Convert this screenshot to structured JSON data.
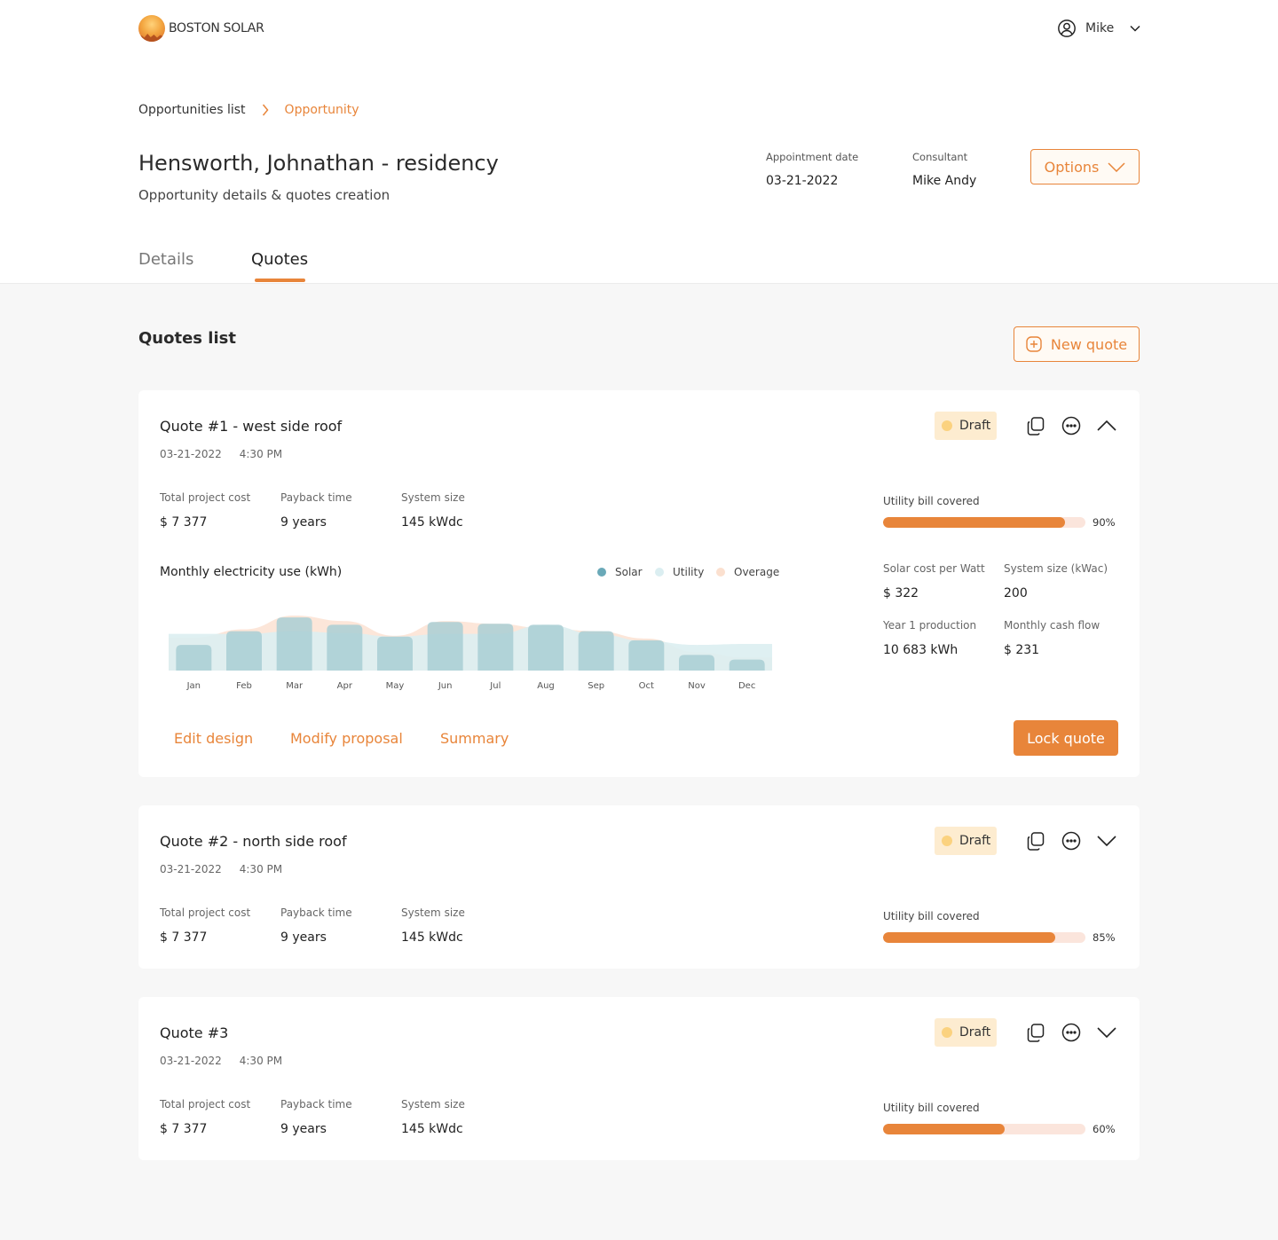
{
  "brand": {
    "name": "BOSTON SOLAR"
  },
  "user": {
    "name": "Mike"
  },
  "breadcrumb": {
    "items": [
      "Opportunities list",
      "Opportunity"
    ]
  },
  "opportunity": {
    "title": "Hensworth, Johnathan - residency",
    "subtitle": "Opportunity details & quotes creation",
    "appointment_label": "Appointment date",
    "appointment_value": "03-21-2022",
    "consultant_label": "Consultant",
    "consultant_value": "Mike Andy",
    "options_label": "Options"
  },
  "tabs": [
    "Details",
    "Quotes"
  ],
  "active_tab": "Quotes",
  "quotes_section": {
    "title": "Quotes list",
    "new_quote_label": "New quote"
  },
  "stat_labels": {
    "cost": "Total project cost",
    "payback": "Payback time",
    "size": "System size",
    "utility": "Utility bill covered",
    "cost_per_watt": "Solar cost per Watt",
    "size_kwac": "System size (kWac)",
    "year1": "Year 1 production",
    "cashflow": "Monthly cash flow"
  },
  "quotes": [
    {
      "title": "Quote #1 - west side roof",
      "date": "03-21-2022",
      "time": "4:30 PM",
      "status": "Draft",
      "expanded": true,
      "total_cost": "$ 7 377",
      "payback": "9 years",
      "system_size": "145 kWdc",
      "utility_pct": 90,
      "utility_pct_label": "90%",
      "cost_per_watt": "$ 322",
      "size_kwac": "200",
      "year1": "10 683 kWh",
      "cashflow": "$ 231",
      "actions": [
        "Edit design",
        "Modify proposal",
        "Summary"
      ],
      "lock_label": "Lock quote"
    },
    {
      "title": "Quote #2 - north side roof",
      "date": "03-21-2022",
      "time": "4:30 PM",
      "status": "Draft",
      "expanded": false,
      "total_cost": "$ 7 377",
      "payback": "9 years",
      "system_size": "145 kWdc",
      "utility_pct": 85,
      "utility_pct_label": "85%"
    },
    {
      "title": "Quote #3",
      "date": "03-21-2022",
      "time": "4:30 PM",
      "status": "Draft",
      "expanded": false,
      "total_cost": "$ 7 377",
      "payback": "9 years",
      "system_size": "145 kWdc",
      "utility_pct": 60,
      "utility_pct_label": "60%"
    }
  ],
  "colors": {
    "accent": "#e8853a",
    "solar": "#6aa9b8",
    "utility": "#dbeef1",
    "overage": "#fbe0cf",
    "bar": "#a9ced4",
    "badge_bg": "#fdecd0",
    "badge_dot": "#fbd27f"
  },
  "icons": {
    "user": "user-circle-icon",
    "dropdown": "chevron-down-icon",
    "breadcrumb_sep": "chevron-right-icon",
    "new_quote": "plus-square-icon",
    "copy": "copy-icon",
    "more": "more-horizontal-icon",
    "collapse": "chevron-up-icon",
    "expand": "chevron-down-icon"
  },
  "chart_data": {
    "type": "bar",
    "title": "Monthly electricity use (kWh)",
    "categories": [
      "Jan",
      "Feb",
      "Mar",
      "Apr",
      "May",
      "Jun",
      "Jul",
      "Aug",
      "Sep",
      "Oct",
      "Nov",
      "Dec"
    ],
    "legend": [
      "Solar",
      "Utility",
      "Overage"
    ],
    "bar_values": [
      28,
      43,
      58,
      50,
      37,
      53,
      51,
      50,
      43,
      33,
      17,
      12
    ],
    "utility_values": [
      40,
      40,
      43,
      41,
      37,
      40,
      40,
      50,
      40,
      32,
      28,
      29
    ],
    "overage_values": [
      36,
      45,
      60,
      54,
      38,
      54,
      51,
      46,
      43,
      35,
      20,
      14
    ],
    "ylim": [
      0,
      60
    ]
  }
}
